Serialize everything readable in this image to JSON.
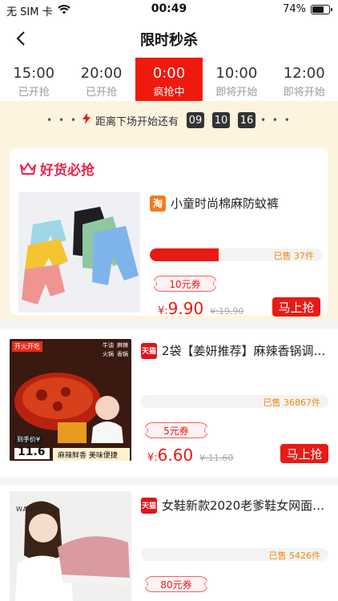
{
  "status_bar": {
    "carrier": "无 SIM 卡",
    "time": "00:49",
    "battery": "74%",
    "battery_level": 0.74
  },
  "nav": {
    "title": "限时秒杀"
  },
  "tabs": [
    {
      "time": "15:00",
      "status": "已开抢",
      "active": false
    },
    {
      "time": "20:00",
      "status": "已开抢",
      "active": false
    },
    {
      "time": "0:00",
      "status": "疯抢中",
      "active": true
    },
    {
      "time": "10:00",
      "status": "即将开始",
      "active": false
    },
    {
      "time": "12:00",
      "status": "即将开始",
      "active": false
    }
  ],
  "countdown": {
    "label": "距离下场开始还有",
    "hours": "09",
    "minutes": "10",
    "seconds": "16"
  },
  "highlight": {
    "heading": "好货必抢",
    "product": {
      "shop_icon": "淘",
      "title": "小童时尚棉麻防蚊裤",
      "sold": "已售 37件",
      "sold_progress": 0.4,
      "coupon": "10元券",
      "currency": "¥:",
      "price": "9.90",
      "original_price": "¥:19.90",
      "buy_label": "马上抢"
    }
  },
  "products": [
    {
      "shop_icon": "天猫",
      "title": "2袋【姜妍推荐】麻辣香锅调…",
      "sold": "已售 36867件",
      "sold_progress": 0.0,
      "coupon": "5元券",
      "currency": "¥:",
      "price": "6.60",
      "original_price": "¥:11.60",
      "buy_label": "马上抢",
      "image_text": {
        "brand": "开火开吃",
        "tag1": "牛油",
        "tag2": "麻辣",
        "tag3": "火锅",
        "tag4": "香锅",
        "price_label": "到手价¥",
        "price_value": "11.6",
        "slogan": "麻辣鲜香 美味便捷"
      }
    },
    {
      "shop_icon": "天猫",
      "title": "女鞋新款2020老爹鞋女网面…",
      "sold": "已售 5426件",
      "sold_progress": 0.0,
      "coupon": "80元券",
      "image_text": {
        "brand": "WANWO"
      }
    }
  ],
  "colors": {
    "accent": "#e81a14",
    "tab_active": "#f0190e",
    "highlight_bg": "#fdf4e0",
    "heading_pink": "#e6254e",
    "sold_orange": "#f28a0c"
  },
  "icons": [
    "wifi-icon",
    "battery-icon",
    "back-chevron-icon",
    "lightning-icon",
    "crown-icon",
    "taobao-icon",
    "tmall-icon"
  ]
}
